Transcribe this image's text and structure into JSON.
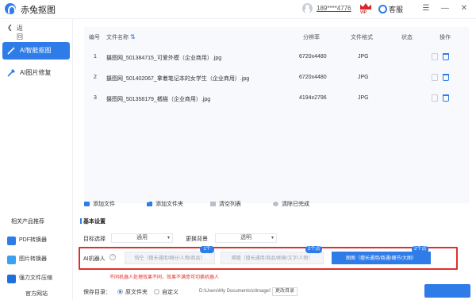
{
  "app": {
    "title": "赤兔抠图"
  },
  "header": {
    "phone": "189****4776",
    "vip_label": "VIP",
    "service_label": "客服"
  },
  "sidebar": {
    "back_label": "返回",
    "nav": [
      {
        "label": "AI智能抠图",
        "active": true
      },
      {
        "label": "AI图片修复",
        "active": false
      }
    ],
    "related_title": "相关产品推荐",
    "products": [
      "PDF转换器",
      "图片转换器",
      "强力文件压缩"
    ],
    "site_link": "官方网站"
  },
  "table": {
    "headers": {
      "index": "编号",
      "name": "文件名称",
      "resolution": "分辨率",
      "format": "文件格式",
      "status": "状态",
      "action": "操作"
    },
    "rows": [
      {
        "index": "1",
        "name": "摄图网_501384715_可爱外模（企业商用）.jpg",
        "resolution": "6720x4480",
        "format": "JPG",
        "status": ""
      },
      {
        "index": "2",
        "name": "摄图网_501402067_拿着笔记本的女学生（企业商用）.jpg",
        "resolution": "6720x4480",
        "format": "JPG",
        "status": ""
      },
      {
        "index": "3",
        "name": "摄图网_501358179_橘猫（企业商用）.jpg",
        "resolution": "4194x2796",
        "format": "JPG",
        "status": ""
      }
    ]
  },
  "toolbar": {
    "add_file": "添加文件",
    "add_folder": "添加文件夹",
    "clear_list": "清空列表",
    "clear_done": "清除已完成"
  },
  "settings": {
    "title": "基本设置",
    "target_label": "目标选择",
    "target_value": "通用",
    "bg_label": "更换背景",
    "bg_value": "透明",
    "robot_label": "AI机器人",
    "robot_options": [
      {
        "label": "悟空（擅长通用/细分/人物/商品）",
        "cost": "1个点",
        "active": false
      },
      {
        "label": "嫦娥（擅长通用/商品/图章/文字/人物）",
        "cost": "2个点",
        "active": false
      },
      {
        "label": "图图（擅长通用/商通/细节/大图）",
        "cost": "2个点",
        "active": true
      }
    ],
    "robot_hint": "不同机器人处理效果不同，效果不满意可切换机器人",
    "save_label": "保存目录：",
    "save_original": "原文件夹",
    "save_custom": "自定义",
    "save_path": "D:\\Users\\My Documents\\ctImageS",
    "change_dir": "更改目录"
  },
  "colors": {
    "accent": "#2f7ce8",
    "highlight": "#e0302b"
  }
}
